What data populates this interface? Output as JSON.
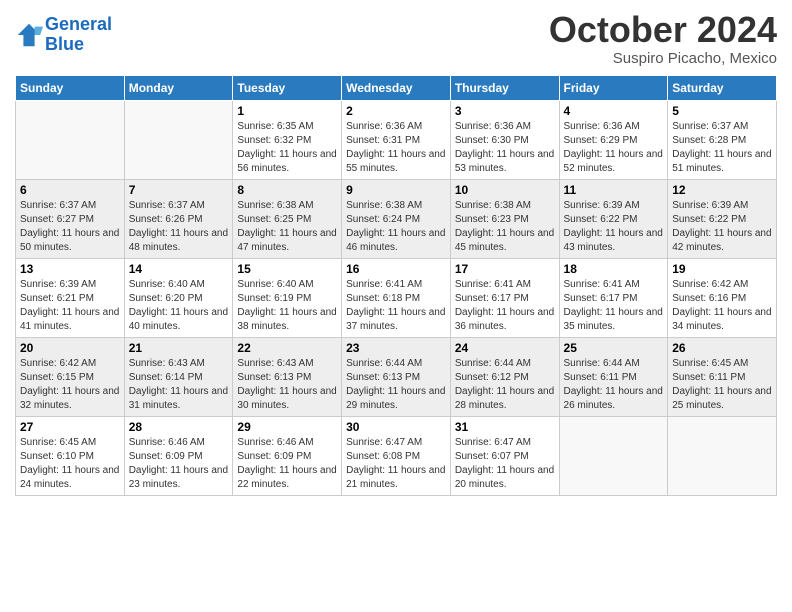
{
  "header": {
    "logo_line1": "General",
    "logo_line2": "Blue",
    "month": "October 2024",
    "location": "Suspiro Picacho, Mexico"
  },
  "weekdays": [
    "Sunday",
    "Monday",
    "Tuesday",
    "Wednesday",
    "Thursday",
    "Friday",
    "Saturday"
  ],
  "weeks": [
    [
      {
        "day": "",
        "info": ""
      },
      {
        "day": "",
        "info": ""
      },
      {
        "day": "1",
        "info": "Sunrise: 6:35 AM\nSunset: 6:32 PM\nDaylight: 11 hours and 56 minutes."
      },
      {
        "day": "2",
        "info": "Sunrise: 6:36 AM\nSunset: 6:31 PM\nDaylight: 11 hours and 55 minutes."
      },
      {
        "day": "3",
        "info": "Sunrise: 6:36 AM\nSunset: 6:30 PM\nDaylight: 11 hours and 53 minutes."
      },
      {
        "day": "4",
        "info": "Sunrise: 6:36 AM\nSunset: 6:29 PM\nDaylight: 11 hours and 52 minutes."
      },
      {
        "day": "5",
        "info": "Sunrise: 6:37 AM\nSunset: 6:28 PM\nDaylight: 11 hours and 51 minutes."
      }
    ],
    [
      {
        "day": "6",
        "info": "Sunrise: 6:37 AM\nSunset: 6:27 PM\nDaylight: 11 hours and 50 minutes."
      },
      {
        "day": "7",
        "info": "Sunrise: 6:37 AM\nSunset: 6:26 PM\nDaylight: 11 hours and 48 minutes."
      },
      {
        "day": "8",
        "info": "Sunrise: 6:38 AM\nSunset: 6:25 PM\nDaylight: 11 hours and 47 minutes."
      },
      {
        "day": "9",
        "info": "Sunrise: 6:38 AM\nSunset: 6:24 PM\nDaylight: 11 hours and 46 minutes."
      },
      {
        "day": "10",
        "info": "Sunrise: 6:38 AM\nSunset: 6:23 PM\nDaylight: 11 hours and 45 minutes."
      },
      {
        "day": "11",
        "info": "Sunrise: 6:39 AM\nSunset: 6:22 PM\nDaylight: 11 hours and 43 minutes."
      },
      {
        "day": "12",
        "info": "Sunrise: 6:39 AM\nSunset: 6:22 PM\nDaylight: 11 hours and 42 minutes."
      }
    ],
    [
      {
        "day": "13",
        "info": "Sunrise: 6:39 AM\nSunset: 6:21 PM\nDaylight: 11 hours and 41 minutes."
      },
      {
        "day": "14",
        "info": "Sunrise: 6:40 AM\nSunset: 6:20 PM\nDaylight: 11 hours and 40 minutes."
      },
      {
        "day": "15",
        "info": "Sunrise: 6:40 AM\nSunset: 6:19 PM\nDaylight: 11 hours and 38 minutes."
      },
      {
        "day": "16",
        "info": "Sunrise: 6:41 AM\nSunset: 6:18 PM\nDaylight: 11 hours and 37 minutes."
      },
      {
        "day": "17",
        "info": "Sunrise: 6:41 AM\nSunset: 6:17 PM\nDaylight: 11 hours and 36 minutes."
      },
      {
        "day": "18",
        "info": "Sunrise: 6:41 AM\nSunset: 6:17 PM\nDaylight: 11 hours and 35 minutes."
      },
      {
        "day": "19",
        "info": "Sunrise: 6:42 AM\nSunset: 6:16 PM\nDaylight: 11 hours and 34 minutes."
      }
    ],
    [
      {
        "day": "20",
        "info": "Sunrise: 6:42 AM\nSunset: 6:15 PM\nDaylight: 11 hours and 32 minutes."
      },
      {
        "day": "21",
        "info": "Sunrise: 6:43 AM\nSunset: 6:14 PM\nDaylight: 11 hours and 31 minutes."
      },
      {
        "day": "22",
        "info": "Sunrise: 6:43 AM\nSunset: 6:13 PM\nDaylight: 11 hours and 30 minutes."
      },
      {
        "day": "23",
        "info": "Sunrise: 6:44 AM\nSunset: 6:13 PM\nDaylight: 11 hours and 29 minutes."
      },
      {
        "day": "24",
        "info": "Sunrise: 6:44 AM\nSunset: 6:12 PM\nDaylight: 11 hours and 28 minutes."
      },
      {
        "day": "25",
        "info": "Sunrise: 6:44 AM\nSunset: 6:11 PM\nDaylight: 11 hours and 26 minutes."
      },
      {
        "day": "26",
        "info": "Sunrise: 6:45 AM\nSunset: 6:11 PM\nDaylight: 11 hours and 25 minutes."
      }
    ],
    [
      {
        "day": "27",
        "info": "Sunrise: 6:45 AM\nSunset: 6:10 PM\nDaylight: 11 hours and 24 minutes."
      },
      {
        "day": "28",
        "info": "Sunrise: 6:46 AM\nSunset: 6:09 PM\nDaylight: 11 hours and 23 minutes."
      },
      {
        "day": "29",
        "info": "Sunrise: 6:46 AM\nSunset: 6:09 PM\nDaylight: 11 hours and 22 minutes."
      },
      {
        "day": "30",
        "info": "Sunrise: 6:47 AM\nSunset: 6:08 PM\nDaylight: 11 hours and 21 minutes."
      },
      {
        "day": "31",
        "info": "Sunrise: 6:47 AM\nSunset: 6:07 PM\nDaylight: 11 hours and 20 minutes."
      },
      {
        "day": "",
        "info": ""
      },
      {
        "day": "",
        "info": ""
      }
    ]
  ]
}
